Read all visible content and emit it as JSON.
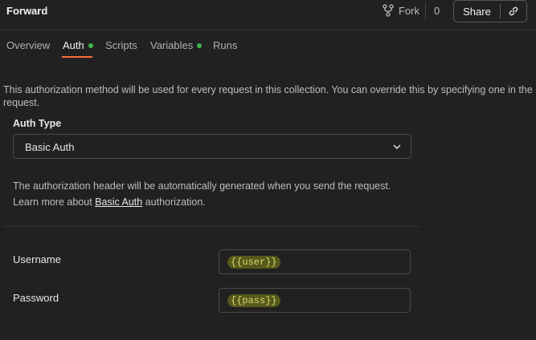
{
  "header": {
    "title": "Forward",
    "fork_label": "Fork",
    "fork_count": "0",
    "share_label": "Share"
  },
  "tabs": [
    {
      "label": "Overview",
      "has_dot": false,
      "active": false
    },
    {
      "label": "Auth",
      "has_dot": true,
      "active": true
    },
    {
      "label": "Scripts",
      "has_dot": false,
      "active": false
    },
    {
      "label": "Variables",
      "has_dot": true,
      "active": false
    },
    {
      "label": "Runs",
      "has_dot": false,
      "active": false
    }
  ],
  "auth": {
    "description": "This authorization method will be used for every request in this collection. You can override this by specifying one in the request.",
    "type_label": "Auth Type",
    "type_value": "Basic Auth",
    "info_line1": "The authorization header will be automatically generated when you send the request.",
    "info_line2_prefix": "Learn more about ",
    "info_line2_link": "Basic Auth",
    "info_line2_suffix": " authorization.",
    "username_label": "Username",
    "username_value": "{{user}}",
    "password_label": "Password",
    "password_value": "{{pass}}"
  },
  "colors": {
    "background": "#212121",
    "accent": "#ff6c37",
    "dot": "#3fb950",
    "variable_highlight": "#55591a"
  }
}
